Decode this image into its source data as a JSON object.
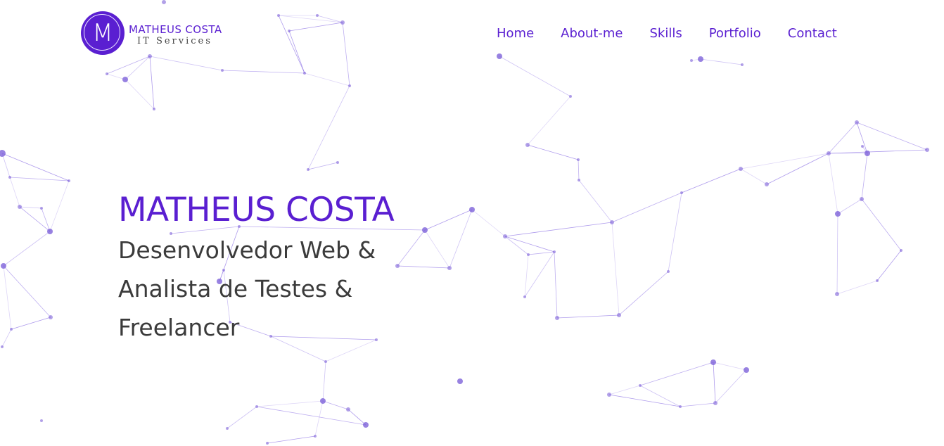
{
  "brand": {
    "logo_letter": "M",
    "name": "MATHEUS COSTA",
    "tagline": "IT Services"
  },
  "nav": {
    "items": [
      "Home",
      "About-me",
      "Skills",
      "Portfolio",
      "Contact"
    ]
  },
  "hero": {
    "name": "MATHEUS COSTA",
    "roles": [
      "Desenvolvedor Web &",
      "Analista de Testes &",
      "Freelancer"
    ]
  },
  "colors": {
    "accent": "#5a1fd1",
    "text_dark": "#3b3b3b",
    "background": "#ffffff",
    "network": "#7b5ce0"
  }
}
